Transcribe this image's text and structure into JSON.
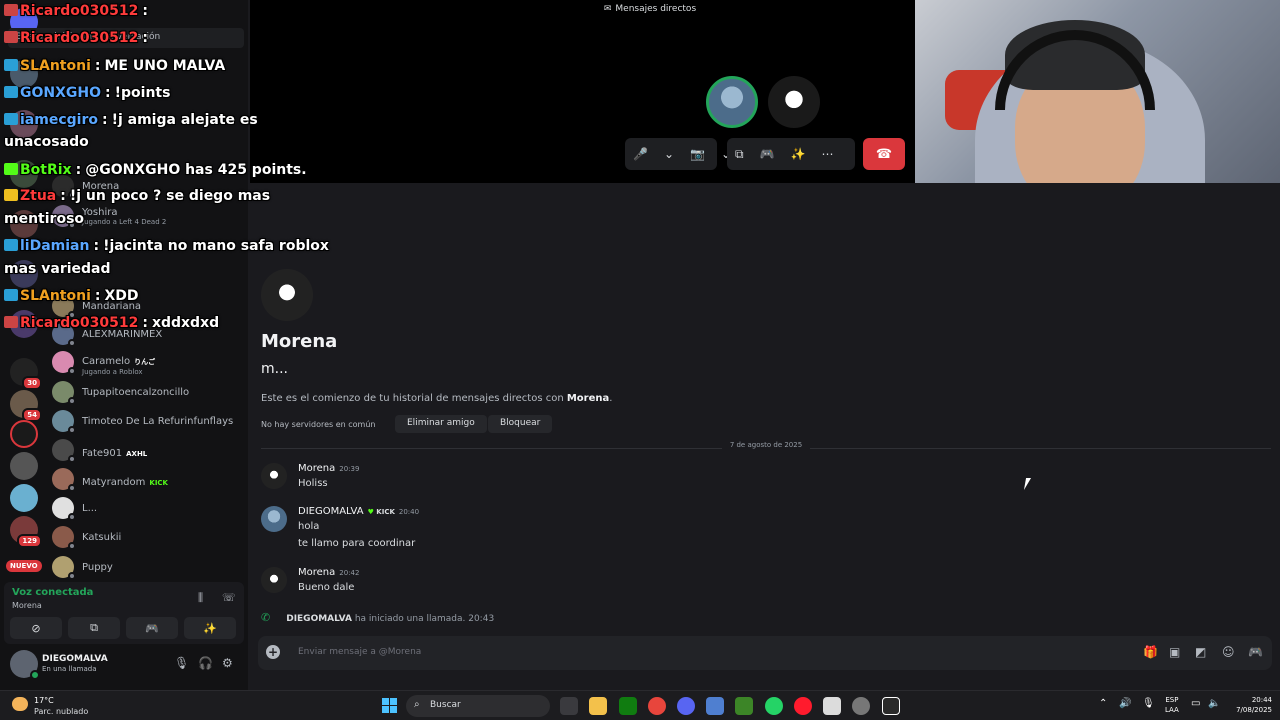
{
  "call": {
    "title": "Mensajes directos",
    "controls": {
      "mic": "🎤",
      "mic_caret": "⌄",
      "cam": "📷",
      "cam_caret": "⌄",
      "screen": "⧉",
      "activity": "🎮",
      "soundboard": "✨",
      "more": "⋯",
      "hangup": "☎"
    }
  },
  "sidebar": {
    "search_text": "Busca o inicia una conversación",
    "dms": [
      {
        "name": "Morena",
        "sub": ""
      },
      {
        "name": "Yoshira",
        "sub": "Jugando a Left 4 Dead 2"
      },
      {
        "name": "Mandariana",
        "sub": ""
      },
      {
        "name": "ALEXMARINMEX",
        "sub": ""
      },
      {
        "name": "Caramelo",
        "tag": "りんご",
        "sub": "Jugando a Roblox"
      },
      {
        "name": "Tupapitoencalzoncillo",
        "sub": ""
      },
      {
        "name": "Timoteo De La Refurinfunflays",
        "sub": ""
      },
      {
        "name": "Fate901",
        "tag": "AXHL",
        "sub": ""
      },
      {
        "name": "Matyrandom",
        "tag": "KICK",
        "sub": ""
      },
      {
        "name": "L...",
        "sub": ""
      },
      {
        "name": "Katsukii",
        "sub": ""
      },
      {
        "name": "Puppy",
        "sub": ""
      }
    ],
    "rail_badges": [
      "30",
      "54",
      "129"
    ],
    "rail_new": "NUEVO"
  },
  "voice": {
    "status": "Voz conectada",
    "channel": "Morena"
  },
  "user": {
    "name": "DIEGOMALVA",
    "status": "En una llamada"
  },
  "profile": {
    "name": "Morena",
    "subtitle": "m...",
    "intro_prefix": "Este es el comienzo de tu historial de mensajes directos con ",
    "intro_name": "Morena",
    "intro_suffix": ".",
    "common": "No hay servidores en común",
    "remove_friend": "Eliminar amigo",
    "block": "Bloquear"
  },
  "messages": {
    "date": "7 de agosto de 2025",
    "m1": {
      "author": "Morena",
      "time": "20:39",
      "lines": [
        "Holiss"
      ]
    },
    "m2": {
      "author": "DIEGOMALVA",
      "tag": "KICK",
      "time": "20:40",
      "lines": [
        "hola",
        "te llamo para coordinar"
      ]
    },
    "m3": {
      "author": "Morena",
      "time": "20:42",
      "lines": [
        "Bueno dale"
      ]
    },
    "system": {
      "author": "DIEGOMALVA",
      "text": "ha iniciado una llamada.",
      "time": "20:43"
    }
  },
  "composer": {
    "placeholder": "Enviar mensaje a @Morena"
  },
  "stream_chat": [
    {
      "user": "Ricardo030512",
      "color": "#ff3b3b",
      "msg": ""
    },
    {
      "user": "Ricardo030512",
      "color": "#ff3b3b",
      "msg": ""
    },
    {
      "user": "SLAntoni",
      "color": "#f0a020",
      "msg": "ME UNO MALVA"
    },
    {
      "user": "GONXGHO",
      "color": "#5aa7ff",
      "msg": "!points"
    },
    {
      "user": "iamecgiro",
      "color": "#5aa7ff",
      "msg": "!j amiga alejate es"
    },
    {
      "user": "",
      "color": "#ffffff",
      "msg": "unacosado"
    },
    {
      "user": "BotRix",
      "color": "#53fc18",
      "msg": "@GONXGHO has 425 points."
    },
    {
      "user": "Ztua",
      "color": "#ff3b3b",
      "msg": "!j un poco ? se diego mas"
    },
    {
      "user": "",
      "color": "#ffffff",
      "msg": "mentiroso"
    },
    {
      "user": "liDamian",
      "color": "#5aa7ff",
      "msg": "!jacinta no mano safa roblox"
    },
    {
      "user": "",
      "color": "#ffffff",
      "msg": "mas variedad"
    },
    {
      "user": "SLAntoni",
      "color": "#f0a020",
      "msg": "XDD"
    },
    {
      "user": "Ricardo030512",
      "color": "#ff3b3b",
      "msg": "xddxdxd"
    }
  ],
  "taskbar": {
    "temp": "17°C",
    "weather": "Parc. nublado",
    "search": "Buscar",
    "lang1": "ESP",
    "lang2": "LAA",
    "time": "20:44",
    "date": "7/08/2025"
  }
}
